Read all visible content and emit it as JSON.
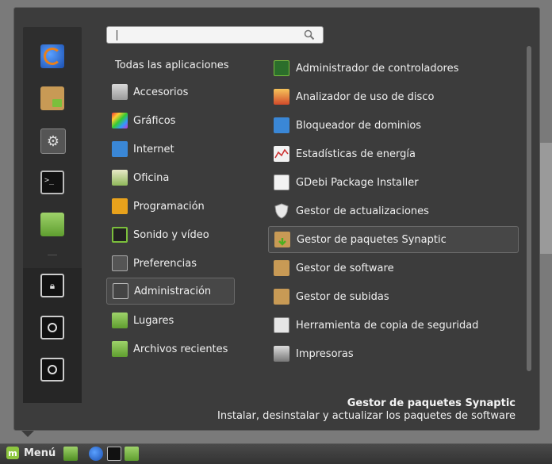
{
  "search": {
    "placeholder": "",
    "value": ""
  },
  "categories": {
    "all_label": "Todas las aplicaciones",
    "items": [
      {
        "label": "Accesorios",
        "icon": "accessories-icon"
      },
      {
        "label": "Gráficos",
        "icon": "graphics-icon"
      },
      {
        "label": "Internet",
        "icon": "internet-icon"
      },
      {
        "label": "Oficina",
        "icon": "office-icon"
      },
      {
        "label": "Programación",
        "icon": "programming-icon"
      },
      {
        "label": "Sonido y vídeo",
        "icon": "sound-video-icon"
      },
      {
        "label": "Preferencias",
        "icon": "preferences-icon"
      },
      {
        "label": "Administración",
        "icon": "administration-icon"
      },
      {
        "label": "Lugares",
        "icon": "places-folder-icon"
      },
      {
        "label": "Archivos recientes",
        "icon": "recent-files-icon"
      }
    ],
    "selected": "Administración"
  },
  "apps": {
    "items": [
      {
        "label": "Administrador de controladores",
        "icon": "driver-manager-icon"
      },
      {
        "label": "Analizador de uso de disco",
        "icon": "disk-usage-icon"
      },
      {
        "label": "Bloqueador de dominios",
        "icon": "domain-blocker-icon"
      },
      {
        "label": "Estadísticas de energía",
        "icon": "power-stats-icon"
      },
      {
        "label": "GDebi Package Installer",
        "icon": "gdebi-icon"
      },
      {
        "label": "Gestor de actualizaciones",
        "icon": "update-manager-shield-icon"
      },
      {
        "label": "Gestor de paquetes Synaptic",
        "icon": "synaptic-icon"
      },
      {
        "label": "Gestor de software",
        "icon": "software-manager-icon"
      },
      {
        "label": "Gestor de subidas",
        "icon": "upload-manager-icon"
      },
      {
        "label": "Herramienta de copia de seguridad",
        "icon": "backup-tool-icon"
      },
      {
        "label": "Impresoras",
        "icon": "printer-icon"
      }
    ],
    "selected": "Gestor de paquetes Synaptic"
  },
  "description": {
    "title": "Gestor de paquetes Synaptic",
    "text": "Instalar, desinstalar y actualizar los paquetes de software"
  },
  "favorites": [
    {
      "icon": "firefox-icon"
    },
    {
      "icon": "software-manager-icon"
    },
    {
      "icon": "system-settings-icon"
    },
    {
      "icon": "terminal-icon"
    },
    {
      "icon": "home-folder-icon"
    },
    {
      "icon": "lock-screen-icon"
    },
    {
      "icon": "logout-icon"
    },
    {
      "icon": "shutdown-icon"
    }
  ],
  "taskbar": {
    "menu_label": "Menú",
    "launchers": [
      {
        "icon": "show-desktop-icon"
      },
      {
        "icon": "firefox-icon"
      },
      {
        "icon": "terminal-icon"
      },
      {
        "icon": "files-folder-icon"
      }
    ]
  },
  "colors": {
    "menu_bg": "#3c3c3c",
    "selected_bg": "#474747",
    "mint_green": "#8dc63f"
  }
}
